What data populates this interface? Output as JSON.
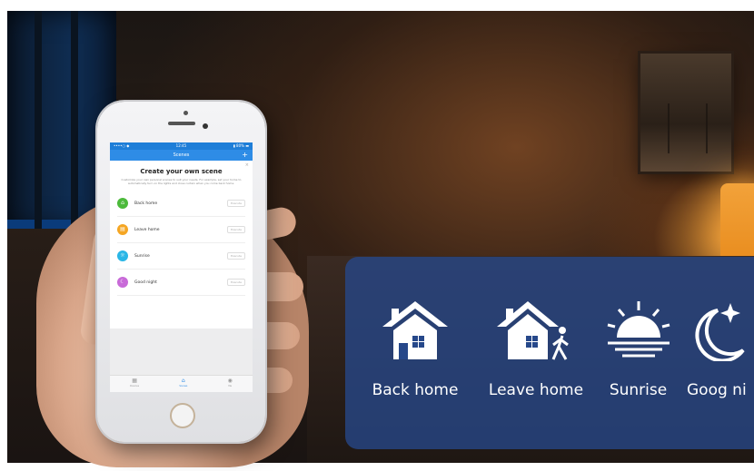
{
  "phone": {
    "status": {
      "left": "••••○ ◆",
      "center": "12:45",
      "right": "▮ 80% ▬"
    },
    "nav_title": "Scenes",
    "nav_plus": "+",
    "close": "×",
    "heading": "Create your own scene",
    "description": "Customize your own personal scenes to suit your needs. For example, set your home to automatically turn on the lights and close curtain when you come back home.",
    "scenes": [
      {
        "label": "Back home",
        "button": "Execute",
        "color": "#4cba3b",
        "icon": "home-icon"
      },
      {
        "label": "Leave home",
        "button": "Execute",
        "color": "#f5a623",
        "icon": "briefcase-icon"
      },
      {
        "label": "Sunrise",
        "button": "Execute",
        "color": "#2ab6e6",
        "icon": "sun-icon"
      },
      {
        "label": "Good night",
        "button": "Execute",
        "color": "#c86ad8",
        "icon": "moon-icon"
      }
    ],
    "tabs": [
      {
        "icon": "grid-icon",
        "glyph": "▦",
        "label": "Devices"
      },
      {
        "icon": "home-icon",
        "glyph": "⌂",
        "label": "Scenes"
      },
      {
        "icon": "profile-icon",
        "glyph": "◉",
        "label": "Me"
      }
    ]
  },
  "panel": {
    "items": [
      {
        "label": "Back home",
        "icon": "house-icon"
      },
      {
        "label": "Leave home",
        "icon": "house-walking-person-icon"
      },
      {
        "label": "Sunrise",
        "icon": "sunrise-icon"
      },
      {
        "label": "Goog ni",
        "icon": "moon-star-icon"
      }
    ]
  }
}
